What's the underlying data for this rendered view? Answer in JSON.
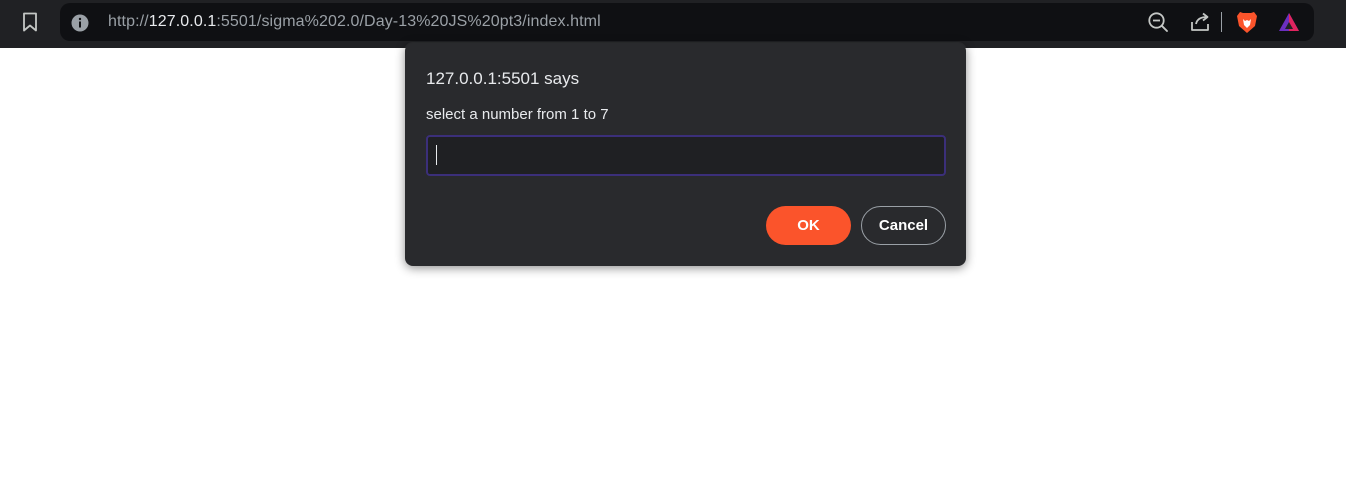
{
  "browser": {
    "url_scheme": "http://",
    "url_host": "127.0.0.1",
    "url_rest": ":5501/sigma%202.0/Day-13%20JS%20pt3/index.html",
    "icons": {
      "bookmark": "bookmark-icon",
      "site_info": "info-icon",
      "zoom": "zoom-out-icon",
      "share": "share-icon",
      "brave_shields": "brave-lion-icon",
      "brave_rewards": "rewards-triangle-icon"
    },
    "colors": {
      "toolbar_bg": "#202124",
      "omnibox_bg": "#0f1013",
      "brave_orange": "#fb542b"
    }
  },
  "dialog": {
    "title": "127.0.0.1:5501 says",
    "message": "select a number from 1 to 7",
    "input_value": "",
    "ok_label": "OK",
    "cancel_label": "Cancel",
    "colors": {
      "background": "#292a2d",
      "ok_button": "#fb542b",
      "input_border": "#3b2f7a"
    }
  }
}
